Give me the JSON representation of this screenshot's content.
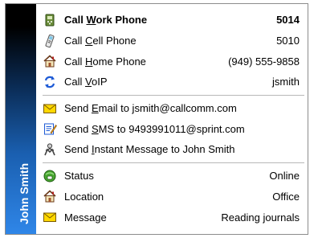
{
  "sidebar": {
    "title": "John Smith"
  },
  "call_group": [
    {
      "name": "call-work-phone",
      "icon": "phone-handset-icon",
      "label_pre": "Call ",
      "label_key": "W",
      "label_post": "ork Phone",
      "value": "5014",
      "bold": true
    },
    {
      "name": "call-cell-phone",
      "icon": "cell-phone-icon",
      "label_pre": "Call ",
      "label_key": "C",
      "label_post": "ell Phone",
      "value": "5010",
      "bold": false
    },
    {
      "name": "call-home-phone",
      "icon": "house-icon",
      "label_pre": "Call ",
      "label_key": "H",
      "label_post": "ome Phone",
      "value": "(949) 555-9858",
      "bold": false
    },
    {
      "name": "call-voip",
      "icon": "voip-arrows-icon",
      "label_pre": "Call ",
      "label_key": "V",
      "label_post": "oIP",
      "value": "jsmith",
      "bold": false
    }
  ],
  "message_group": [
    {
      "name": "send-email",
      "icon": "envelope-icon",
      "label_pre": "Send ",
      "label_key": "E",
      "label_post": "mail to jsmith@callcomm.com"
    },
    {
      "name": "send-sms",
      "icon": "sms-notepad-icon",
      "label_pre": "Send ",
      "label_key": "S",
      "label_post": "MS to 9493991011@sprint.com"
    },
    {
      "name": "send-im",
      "icon": "chat-buddy-icon",
      "label_pre": "Send ",
      "label_key": "I",
      "label_post": "nstant Message to John Smith"
    }
  ],
  "status_group": [
    {
      "name": "status",
      "icon": "status-globe-icon",
      "label": "Status",
      "value": "Online"
    },
    {
      "name": "location",
      "icon": "house-icon",
      "label": "Location",
      "value": "Office"
    },
    {
      "name": "message",
      "icon": "envelope-icon",
      "label": "Message",
      "value": "Reading journals"
    }
  ],
  "colors": {
    "sidebar_top": "#000000",
    "sidebar_bottom": "#2f86e8",
    "sidebar_text": "#ffffff",
    "separator": "#b8b8b8"
  }
}
